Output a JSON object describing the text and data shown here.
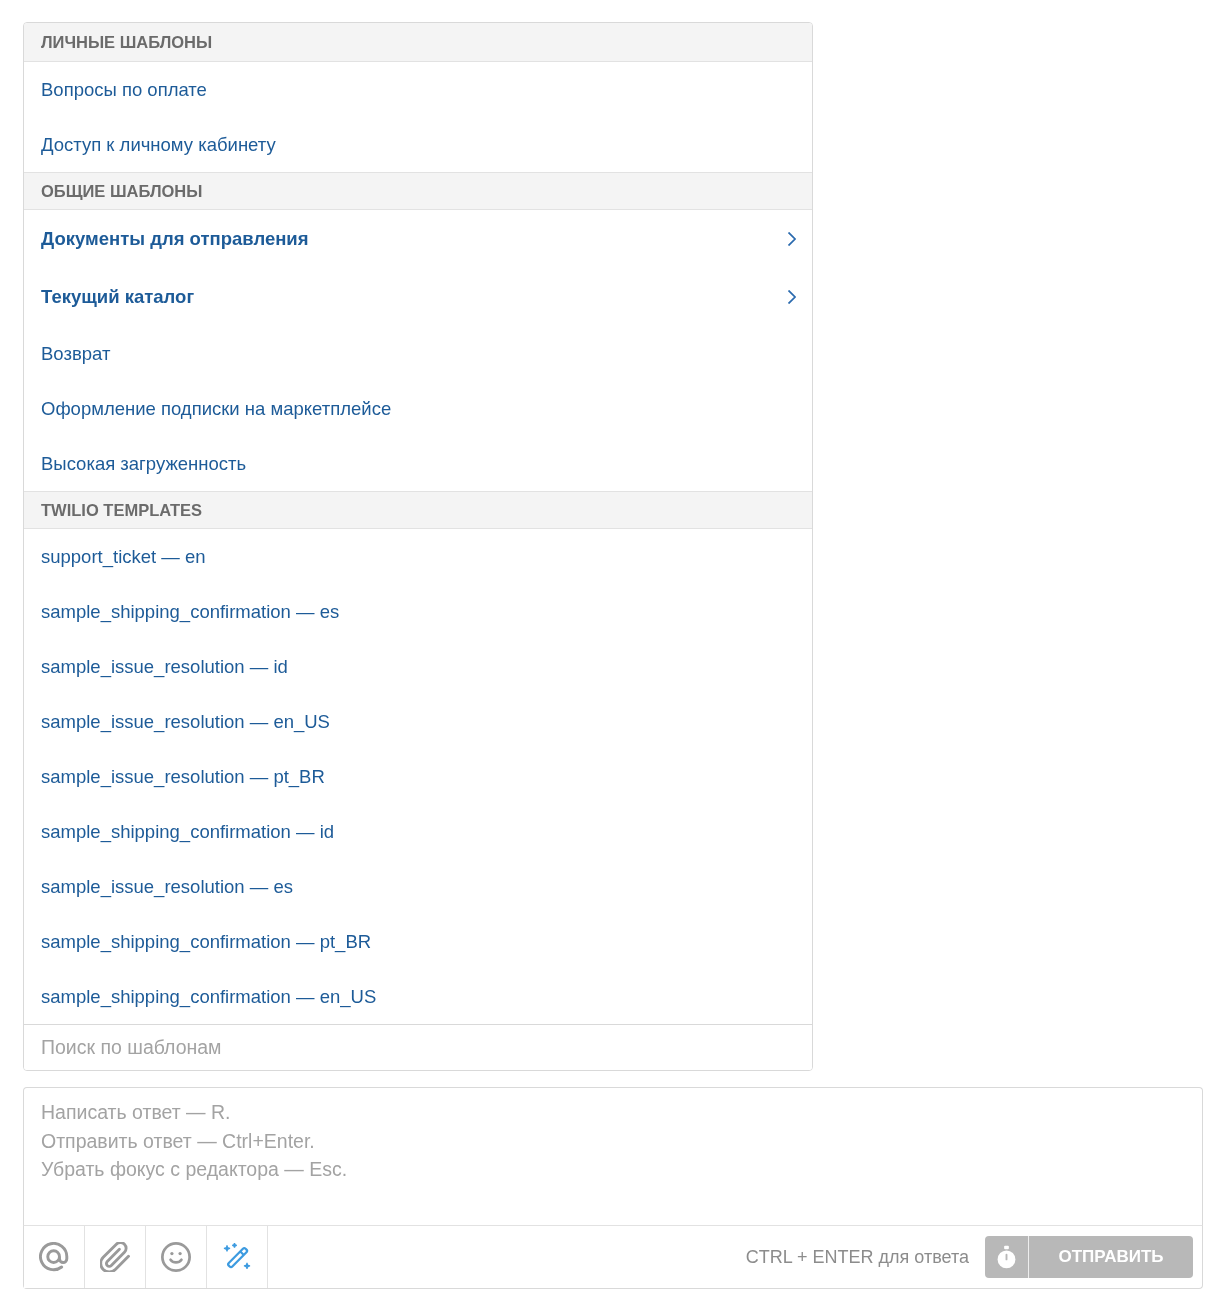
{
  "templates_panel": {
    "sections": [
      {
        "title": "ЛИЧНЫЕ ШАБЛОНЫ",
        "items": [
          {
            "label": "Вопросы по оплате",
            "kind": "template"
          },
          {
            "label": "Доступ к личному кабинету",
            "kind": "template"
          }
        ]
      },
      {
        "title": "ОБЩИЕ ШАБЛОНЫ",
        "items": [
          {
            "label": "Документы для отправления",
            "kind": "folder"
          },
          {
            "label": "Текущий каталог",
            "kind": "folder"
          },
          {
            "label": "Возврат",
            "kind": "template"
          },
          {
            "label": "Оформление подписки на маркетплейсе",
            "kind": "template"
          },
          {
            "label": "Высокая загруженность",
            "kind": "template"
          }
        ]
      },
      {
        "title": "TWILIO TEMPLATES",
        "items": [
          {
            "label": "support_ticket — en",
            "kind": "template"
          },
          {
            "label": "sample_shipping_confirmation — es",
            "kind": "template"
          },
          {
            "label": "sample_issue_resolution — id",
            "kind": "template"
          },
          {
            "label": "sample_issue_resolution — en_US",
            "kind": "template"
          },
          {
            "label": "sample_issue_resolution — pt_BR",
            "kind": "template"
          },
          {
            "label": "sample_shipping_confirmation — id",
            "kind": "template"
          },
          {
            "label": "sample_issue_resolution — es",
            "kind": "template"
          },
          {
            "label": "sample_shipping_confirmation — pt_BR",
            "kind": "template"
          },
          {
            "label": "sample_shipping_confirmation — en_US",
            "kind": "template"
          }
        ]
      }
    ],
    "search": {
      "placeholder": "Поиск по шаблонам"
    }
  },
  "reply_editor": {
    "placeholder": "Написать ответ — R.\nОтправить ответ — Ctrl+Enter.\nУбрать фокус с редактора — Esc.",
    "shortcut_hint": "CTRL + ENTER для ответа",
    "schedule_button": {
      "disabled": true
    },
    "send_button": {
      "label": "ОТПРАВИТЬ",
      "disabled": true
    }
  }
}
